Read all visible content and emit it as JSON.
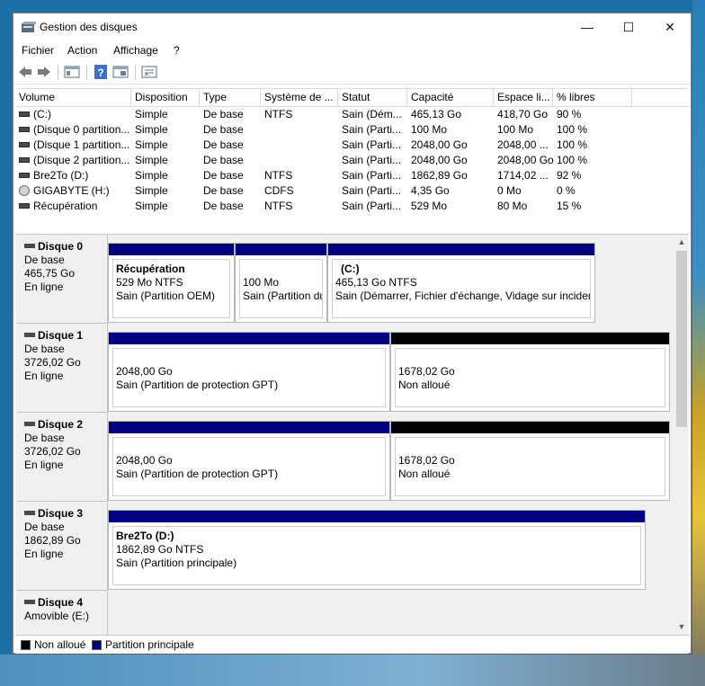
{
  "window": {
    "title": "Gestion des disques",
    "minimize": "—",
    "maximize": "☐",
    "close": "✕"
  },
  "menu": [
    "Fichier",
    "Action",
    "Affichage",
    "?"
  ],
  "colors": {
    "primary_partition": "#000080",
    "unallocated": "#000000"
  },
  "volume_list": {
    "headers": [
      "Volume",
      "Disposition",
      "Type",
      "Système de ...",
      "Statut",
      "Capacité",
      "Espace li...",
      "% libres"
    ],
    "rows": [
      {
        "icon": "volume-icon",
        "volume": "(C:)",
        "disposition": "Simple",
        "type": "De base",
        "fs": "NTFS",
        "status": "Sain (Dém...",
        "capacity": "465,13 Go",
        "free": "418,70 Go",
        "pct": "90 %"
      },
      {
        "icon": "volume-icon",
        "volume": "(Disque 0 partition...",
        "disposition": "Simple",
        "type": "De base",
        "fs": "",
        "status": "Sain (Parti...",
        "capacity": "100 Mo",
        "free": "100 Mo",
        "pct": "100 %"
      },
      {
        "icon": "volume-icon",
        "volume": "(Disque 1 partition...",
        "disposition": "Simple",
        "type": "De base",
        "fs": "",
        "status": "Sain (Parti...",
        "capacity": "2048,00 Go",
        "free": "2048,00 ...",
        "pct": "100 %"
      },
      {
        "icon": "volume-icon",
        "volume": "(Disque 2 partition...",
        "disposition": "Simple",
        "type": "De base",
        "fs": "",
        "status": "Sain (Parti...",
        "capacity": "2048,00 Go",
        "free": "2048,00 Go",
        "pct": "100 %"
      },
      {
        "icon": "volume-icon",
        "volume": "Bre2To (D:)",
        "disposition": "Simple",
        "type": "De base",
        "fs": "NTFS",
        "status": "Sain (Parti...",
        "capacity": "1862,89 Go",
        "free": "1714,02 ...",
        "pct": "92 %"
      },
      {
        "icon": "cd-icon",
        "volume": "GIGABYTE (H:)",
        "disposition": "Simple",
        "type": "De base",
        "fs": "CDFS",
        "status": "Sain (Parti...",
        "capacity": "4,35 Go",
        "free": "0 Mo",
        "pct": "0 %"
      },
      {
        "icon": "volume-icon",
        "volume": "Récupération",
        "disposition": "Simple",
        "type": "De base",
        "fs": "NTFS",
        "status": "Sain (Parti...",
        "capacity": "529 Mo",
        "free": "80 Mo",
        "pct": "15 %"
      }
    ]
  },
  "disks": [
    {
      "name": "Disque 0",
      "type": "De base",
      "size": "465,75 Go",
      "status": "En ligne"
    },
    {
      "name": "Disque 1",
      "type": "De base",
      "size": "3726,02 Go",
      "status": "En ligne"
    },
    {
      "name": "Disque 2",
      "type": "De base",
      "size": "3726,02 Go",
      "status": "En ligne"
    },
    {
      "name": "Disque 3",
      "type": "De base",
      "size": "1862,89 Go",
      "status": "En ligne"
    },
    {
      "name": "Disque 4",
      "type": "Amovible (E:)",
      "size": "",
      "status": ""
    }
  ],
  "partitions": {
    "d0_recovery": {
      "label": "Récupération",
      "size": "529 Mo NTFS",
      "status": "Sain (Partition OEM)"
    },
    "d0_efi": {
      "size": "100 Mo",
      "status": "Sain (Partition du"
    },
    "d0_c": {
      "label": "(C:)",
      "size": "465,13 Go NTFS",
      "status": "Sain (Démarrer, Fichier d'échange, Vidage sur inciden"
    },
    "d1_gpt": {
      "size": "2048,00 Go",
      "status": "Sain (Partition de protection GPT)"
    },
    "d1_free": {
      "size": "1678,02 Go",
      "status": "Non alloué"
    },
    "d2_gpt": {
      "size": "2048,00 Go",
      "status": "Sain (Partition de protection GPT)"
    },
    "d2_free": {
      "size": "1678,02 Go",
      "status": "Non alloué"
    },
    "d3_d": {
      "label": "Bre2To  (D:)",
      "size": "1862,89 Go NTFS",
      "status": "Sain (Partition principale)"
    }
  },
  "legend": {
    "unallocated": "Non alloué",
    "primary": "Partition principale"
  }
}
